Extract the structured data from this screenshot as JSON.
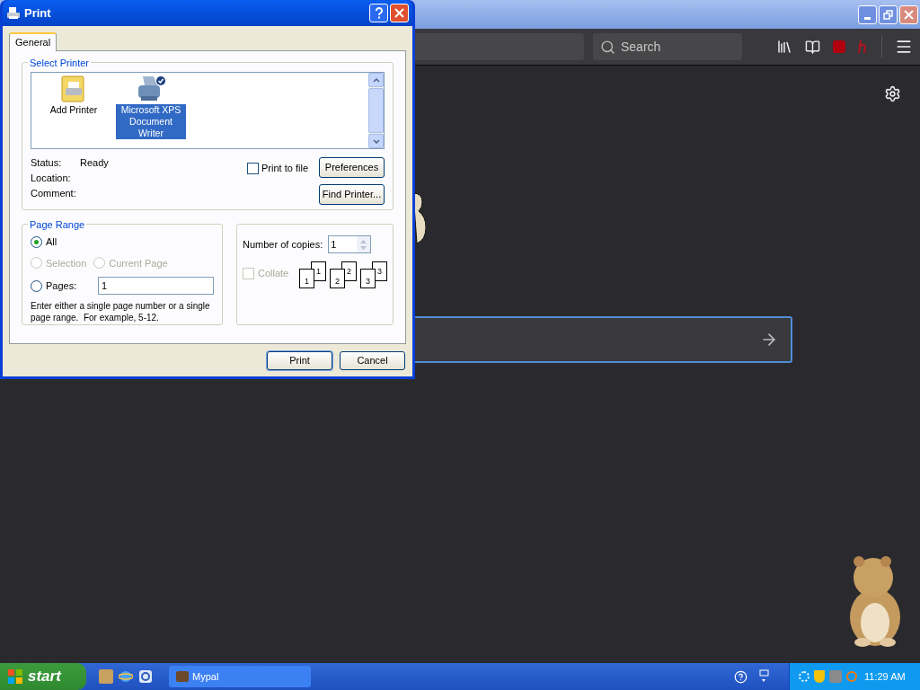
{
  "browser": {
    "search_placeholder": "Search"
  },
  "dialog": {
    "title": "Print",
    "tabs": [
      {
        "label": "General",
        "selected": true
      }
    ],
    "select_printer": {
      "legend": "Select Printer",
      "printers": [
        {
          "name": "Add Printer",
          "kind": "add",
          "selected": false
        },
        {
          "name": "Microsoft XPS Document Writer",
          "kind": "printer",
          "selected": true
        }
      ],
      "status_label": "Status:",
      "status": "Ready",
      "location_label": "Location:",
      "comment_label": "Comment:",
      "print_to_file": {
        "label": "Print to file",
        "checked": false
      },
      "buttons": [
        "Preferences",
        "Find Printer..."
      ]
    },
    "page_range": {
      "legend": "Page Range",
      "options": [
        {
          "label": "All",
          "selected": true,
          "disabled": false
        },
        {
          "label": "Selection",
          "selected": false,
          "disabled": true
        },
        {
          "label": "Current Page",
          "selected": false,
          "disabled": true
        },
        {
          "label": "Pages:",
          "selected": false,
          "disabled": false
        }
      ],
      "pages_value": "1",
      "hint": "Enter either a single page number or a single page range.  For example, 5-12."
    },
    "copies": {
      "label": "Number of copies:",
      "value": "1",
      "collate": {
        "label": "Collate",
        "checked": false,
        "disabled": true
      },
      "collate_pages": [
        "1",
        "1",
        "2",
        "2",
        "3",
        "3"
      ]
    },
    "buttons": [
      {
        "label": "Print",
        "default": true
      },
      {
        "label": "Cancel",
        "default": false
      }
    ]
  },
  "taskbar": {
    "start": "start",
    "tasks": [
      {
        "label": "Mypal",
        "selected": false
      }
    ],
    "clock": "11:29 AM"
  }
}
